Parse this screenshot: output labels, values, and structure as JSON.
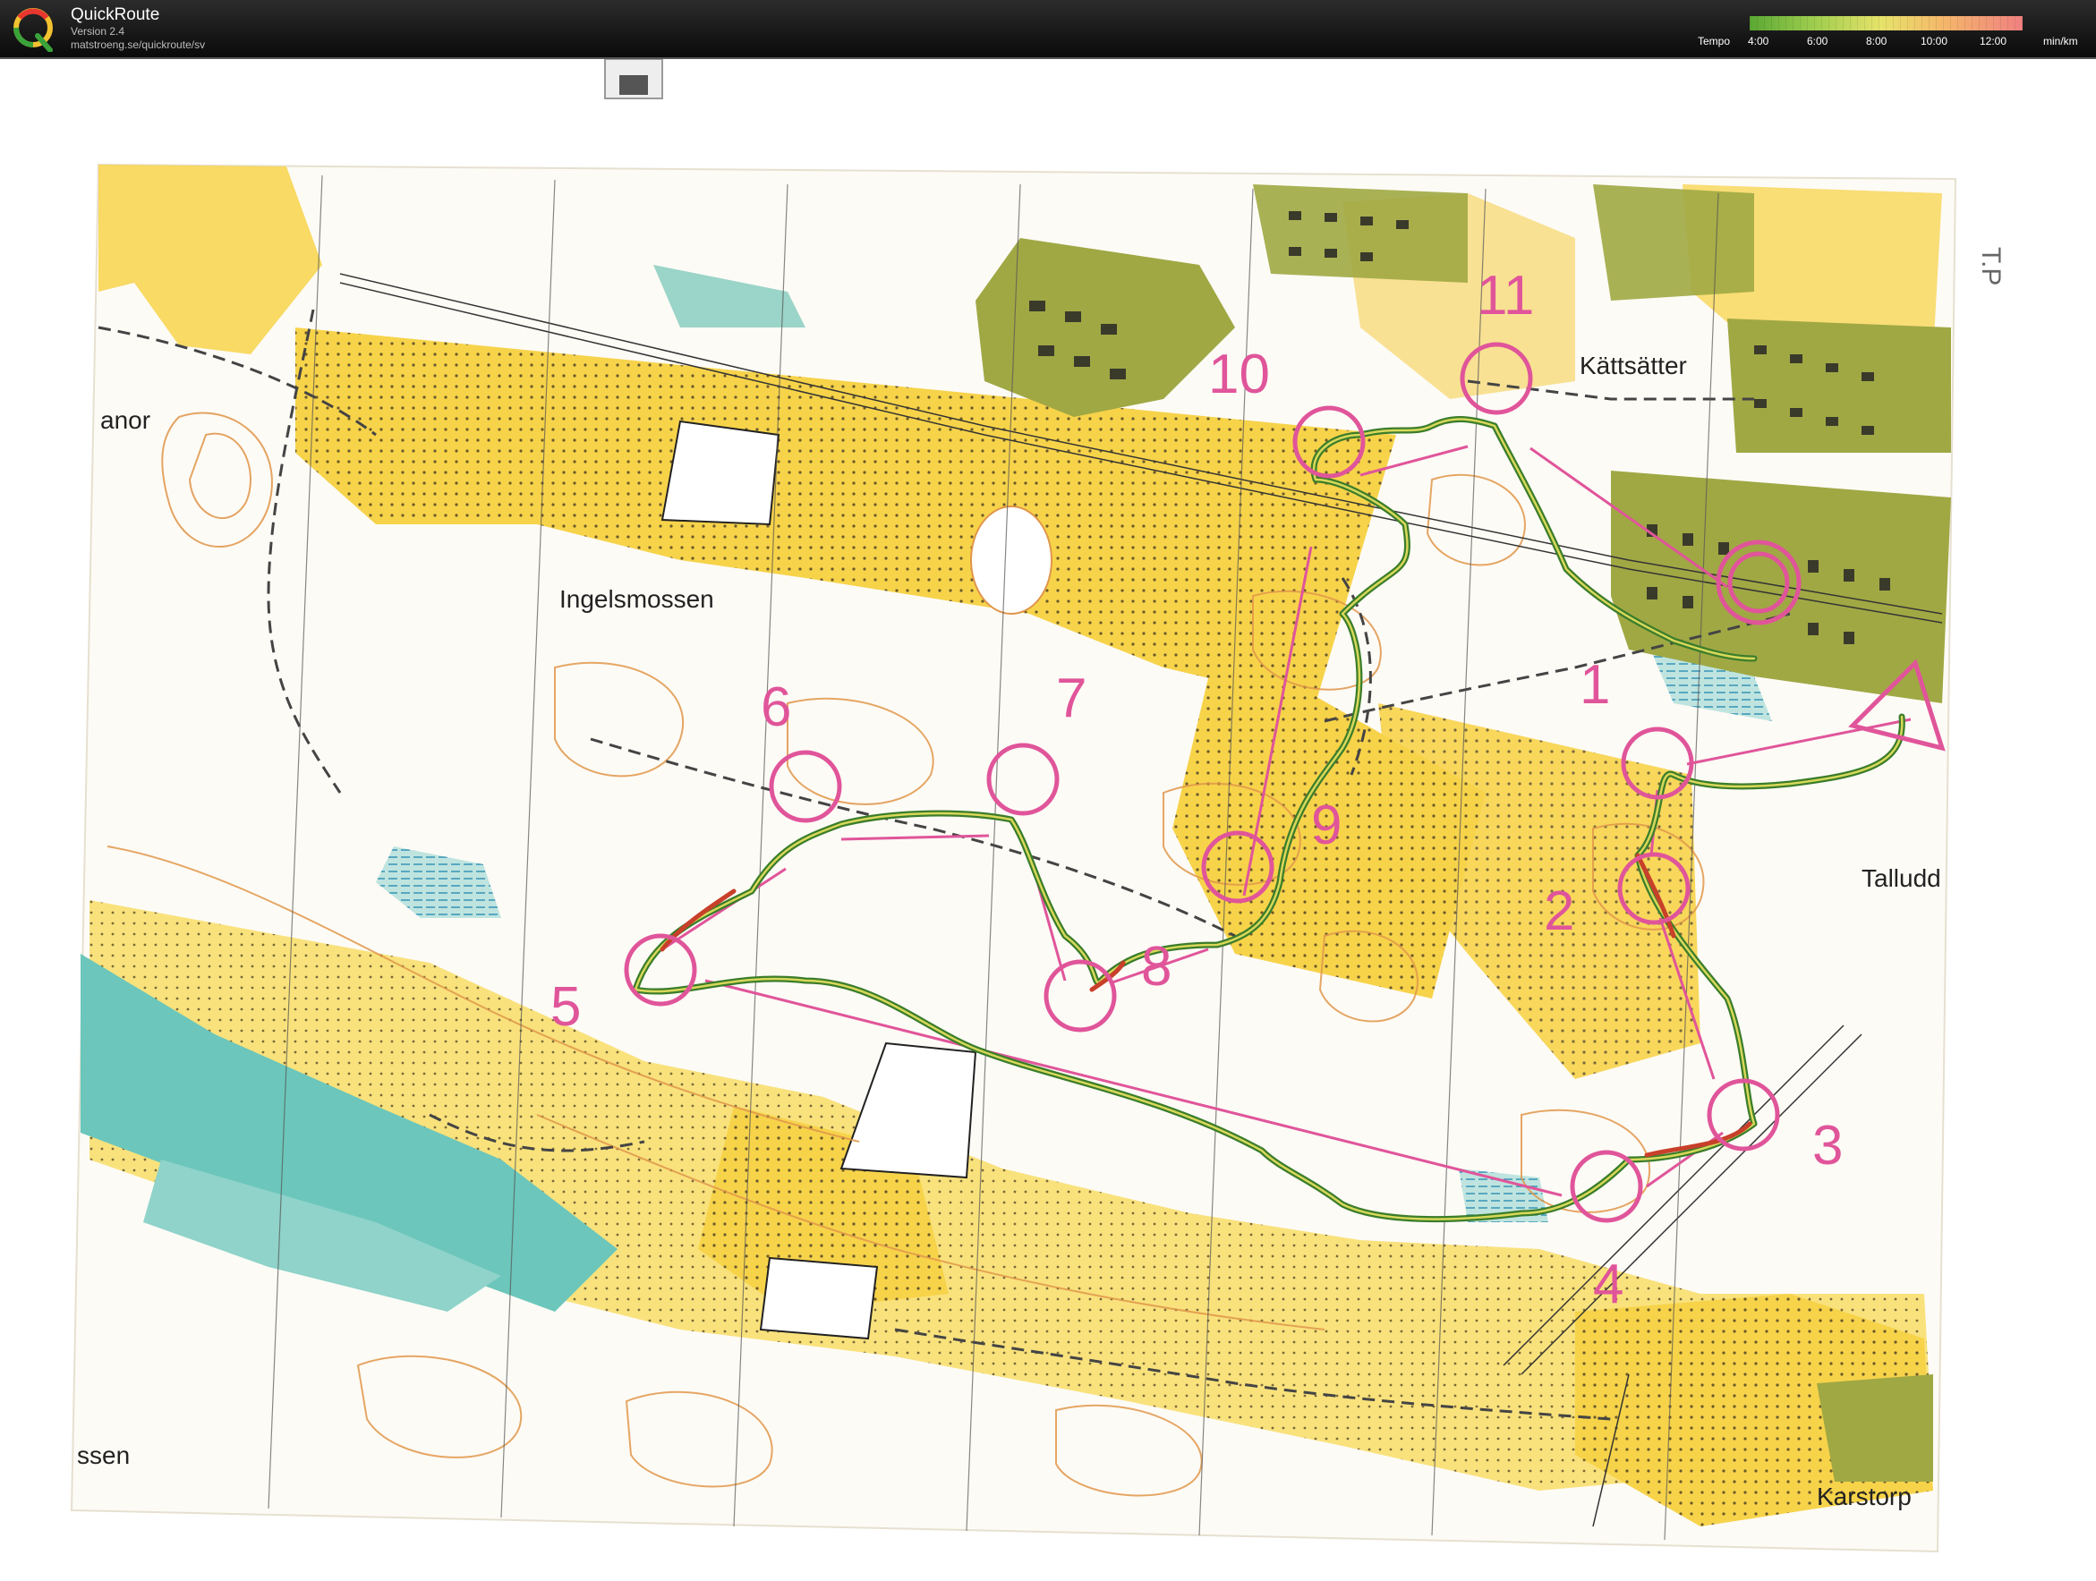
{
  "app": {
    "name": "QuickRoute",
    "version": "Version 2.4",
    "url": "matstroeng.se/quickroute/sv"
  },
  "tempo_scale": {
    "label": "Tempo",
    "ticks": [
      "4:00",
      "6:00",
      "8:00",
      "10:00",
      "12:00"
    ],
    "unit": "min/km",
    "colors": [
      "#5aa834",
      "#9acb4c",
      "#e6e36a",
      "#f4b96a",
      "#f08080"
    ]
  },
  "map": {
    "colors": {
      "open_yellow": "#f7d34a",
      "forest_white": "#fdfbf6",
      "water_cyan": "#6cc6bb",
      "control_magenta": "#e0559a",
      "built_olive": "#a0a844",
      "contour_brown": "#e0964a",
      "route_green": "#3b7d2a"
    },
    "place_names": {
      "ingelsmossen": "Ingelsmossen",
      "kattsatter": "Kättsätter",
      "talludd": "Talludd",
      "karstorp": "Karstorp",
      "anor": "anor",
      "ssen": "ssen",
      "margin_note": "T.P"
    },
    "controls": [
      {
        "label": "1"
      },
      {
        "label": "2"
      },
      {
        "label": "3"
      },
      {
        "label": "4"
      },
      {
        "label": "5"
      },
      {
        "label": "6"
      },
      {
        "label": "7"
      },
      {
        "label": "8"
      },
      {
        "label": "9"
      },
      {
        "label": "10"
      },
      {
        "label": "11"
      }
    ]
  }
}
